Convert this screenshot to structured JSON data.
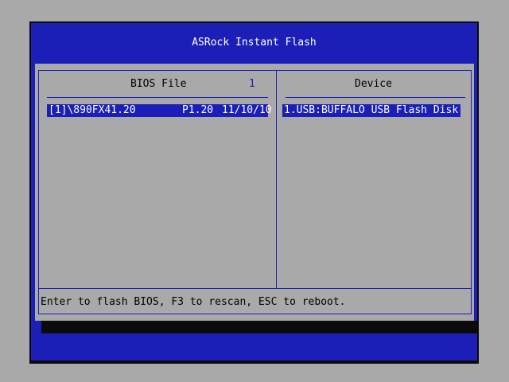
{
  "window": {
    "title": "ASRock Instant Flash"
  },
  "bios_panel": {
    "header": "BIOS File",
    "count": "1",
    "files": [
      {
        "name": "[1]\\890FX41.20",
        "version": "P1.20",
        "date": "11/10/10"
      }
    ]
  },
  "device_panel": {
    "header": "Device",
    "devices": [
      {
        "label": "1.USB:BUFFALO USB Flash Disk"
      }
    ]
  },
  "footer": {
    "help": "Enter to flash BIOS, F3 to rescan, ESC to reboot."
  },
  "colors": {
    "frame_blue": "#1b1fb7",
    "panel_gray": "#a9a9a9",
    "selection_text": "#ffffff"
  }
}
